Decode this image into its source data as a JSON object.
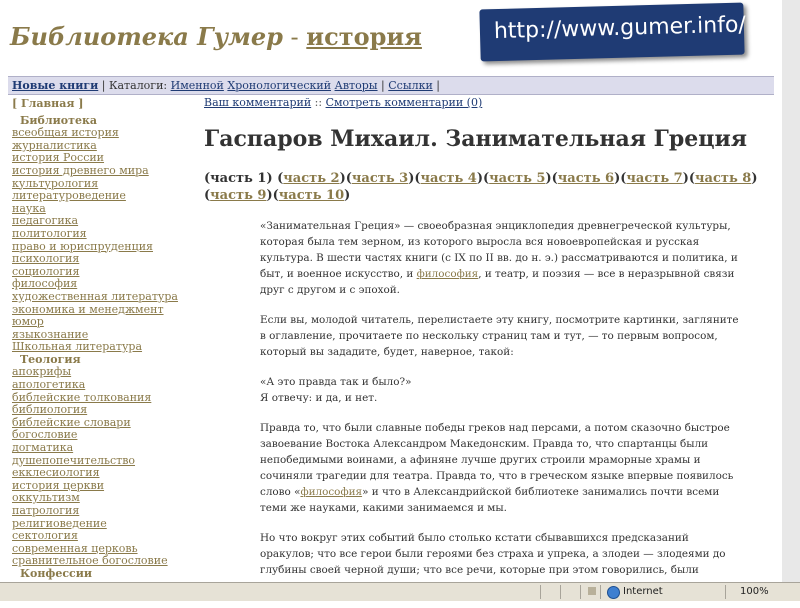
{
  "header": {
    "brand_main": "Библиотека Гумер",
    "brand_sep": " - ",
    "brand_sub": "история",
    "url_banner": "http://www.gumer.info/"
  },
  "navbar": {
    "first": "Новые книги",
    "sep1": " | ",
    "catalogs_label": "Каталоги: ",
    "links": [
      "Именной",
      "Хронологический",
      "Авторы"
    ],
    "sep2": " | ",
    "links_item": "Ссылки",
    "sep3": " |"
  },
  "sidebar": {
    "home": "[ Главная ]",
    "sections": [
      {
        "title": "Библиотека",
        "items": [
          "всеобщая история",
          "журналистика",
          "история России",
          "история древнего мира",
          "культурология",
          "литературоведение",
          "наука",
          "педагогика",
          "политология",
          "право и юриспруденция",
          "психология",
          "социология",
          "философия",
          "художественная литература",
          "экономика и менеджмент",
          "юмор",
          "языкознание",
          "Школьная литература"
        ]
      },
      {
        "title": "Теология",
        "items": [
          "апокрифы",
          "апологетика",
          "библейские толкования",
          "библиология",
          "библейские словари",
          "богословие",
          "догматика",
          "душепопечительство",
          "екклесиология",
          "история церкви",
          "оккультизм",
          "патрология",
          "религиоведение",
          "сектология",
          "современная церковь",
          "сравнительное богословие"
        ]
      },
      {
        "title": "Конфессии",
        "items": []
      }
    ]
  },
  "main": {
    "comment_link": "Ваш комментарий",
    "comment_sep": " :: ",
    "view_comments": "Смотреть комментарии (0)",
    "title": "Гаспаров Михаил. Занимательная Греция",
    "parts_first": "(часть 1)",
    "parts": [
      "часть 2",
      "часть 3",
      "часть 4",
      "часть 5",
      "часть 6",
      "часть 7",
      "часть 8",
      "часть 9",
      "часть 10"
    ],
    "paragraphs": [
      {
        "pre": "«Занимательная Греция» — своеобразная энциклопедия древнегреческой культуры, которая была тем зерном, из которого выросла вся новоевропейская и русская культура. В шести частях книги (с IX по II вв. до н. э.) рассматриваются и политика, и быт, и военное искусство, и ",
        "link": "философия",
        "post": ", и театр, и поэзия — все в неразрывной связи друг с другом и с эпохой."
      },
      {
        "pre": "Если вы, молодой читатель, перелистаете эту книгу, посмотрите картинки, загляните в оглавление, прочитаете по нескольку страниц там и тут, — то первым вопросом, который вы зададите, будет, наверное, такой:",
        "link": "",
        "post": ""
      },
      {
        "pre": "«А это правда так и было?»",
        "link": "",
        "post": "",
        "line2": "Я отвечу: и да, и нет."
      },
      {
        "pre": "Правда то, что были славные победы греков над персами, а потом сказочно быстрое завоевание Востока Александром Македонским. Правда то, что спартанцы были непобедимыми воинами, а афиняне лучше других строили мраморные храмы и сочиняли трагедии для театра. Правда то, что в греческом языке впервые появилось слово «",
        "link": "философия",
        "post": "» и что в Александрийской библиотеке занимались почти всеми теми же науками, какими занимаемся и мы."
      },
      {
        "pre": "Но что вокруг этих событий было столько кстати сбывавшихся предсказаний оракулов; что все герои были героями без страха и упрека, а злодеи — злодеями до глубины своей черной души; что все речи, которые при этом говорились, были такими",
        "link": "",
        "post": ""
      }
    ]
  },
  "statusbar": {
    "zone": "Internet",
    "zoom": "100%"
  },
  "colors": {
    "accent": "#8a7a4a",
    "link_blue": "#1f3b74",
    "banner_bg": "#1f3b74",
    "navbar_bg": "#dcdcec"
  }
}
